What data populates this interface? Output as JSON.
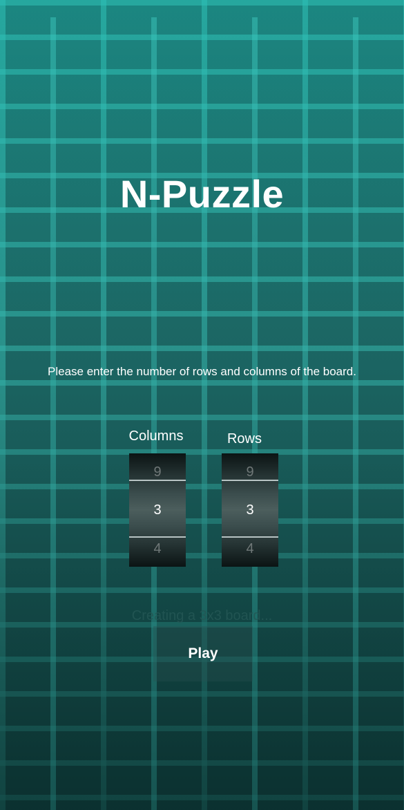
{
  "app": {
    "title": "N-Puzzle",
    "instructions": "Please enter the number of rows and columns of the board."
  },
  "columns_picker": {
    "label": "Columns",
    "prev": "9",
    "selected": "3",
    "next": "4"
  },
  "rows_picker": {
    "label": "Rows",
    "prev": "9",
    "selected": "3",
    "next": "4"
  },
  "status": "Creating a 3x3 board...",
  "play_button": "Play",
  "colors": {
    "background": "#1f6e6b",
    "mortar": "#3cc8be",
    "text": "#ffffff"
  }
}
